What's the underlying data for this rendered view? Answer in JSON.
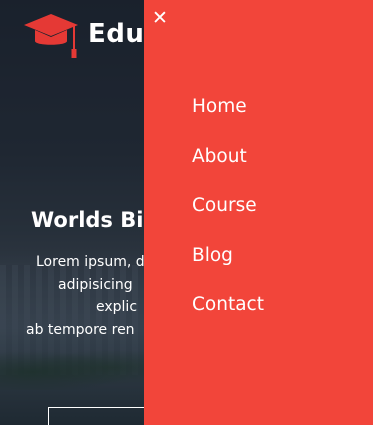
{
  "brand": {
    "name": "Edu",
    "icon": "graduation-cap-icon",
    "icon_color": "#e53935"
  },
  "hero": {
    "headline": "Worlds Bi",
    "lead_lines": [
      "Lorem ipsum, d",
      "adipisicing",
      "explic",
      "ab tempore ren"
    ]
  },
  "drawer": {
    "background": "#f2453a",
    "close_icon": "close-icon",
    "close_glyph": "✕",
    "menu": [
      {
        "label": "Home"
      },
      {
        "label": "About"
      },
      {
        "label": "Course"
      },
      {
        "label": "Blog"
      },
      {
        "label": "Contact"
      }
    ]
  }
}
